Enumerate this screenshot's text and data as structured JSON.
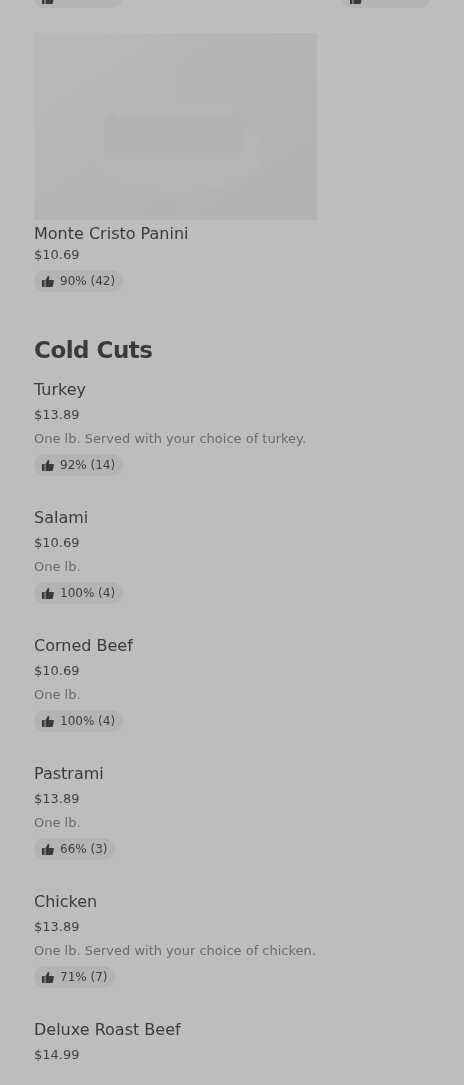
{
  "top_item": {
    "kind": "picture",
    "name": "Monte Cristo Panini",
    "price": "$10.69",
    "rating": "90% (42)"
  },
  "section": {
    "title": "Cold Cuts",
    "items": [
      {
        "name": "Turkey",
        "price": "$13.89",
        "description": "One lb. Served with your choice of turkey.",
        "rating": "92% (14)"
      },
      {
        "name": "Salami",
        "price": "$10.69",
        "description": "One lb.",
        "rating": "100% (4)"
      },
      {
        "name": "Corned Beef",
        "price": "$10.69",
        "description": "One lb.",
        "rating": "100% (4)"
      },
      {
        "name": "Pastrami",
        "price": "$13.89",
        "description": "One lb.",
        "rating": "66% (3)"
      },
      {
        "name": "Chicken",
        "price": "$13.89",
        "description": "One lb. Served with your choice of chicken.",
        "rating": "71% (7)"
      },
      {
        "name": "Deluxe Roast Beef",
        "price": "$14.99"
      }
    ]
  }
}
